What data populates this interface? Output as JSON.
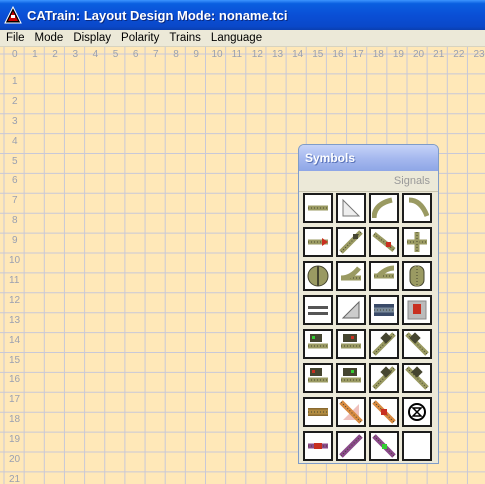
{
  "window": {
    "title": "CATrain: Layout Design Mode: noname.tci"
  },
  "menu": {
    "items": [
      "File",
      "Mode",
      "Display",
      "Polarity",
      "Trains",
      "Language"
    ]
  },
  "grid": {
    "columns": [
      "0",
      "1",
      "2",
      "3",
      "4",
      "5",
      "6",
      "7",
      "8",
      "9",
      "10",
      "11",
      "12",
      "13",
      "14",
      "15",
      "16",
      "17",
      "18",
      "19",
      "20",
      "21",
      "22",
      "23"
    ],
    "rows": [
      "0",
      "1",
      "2",
      "3",
      "4",
      "5",
      "6",
      "7",
      "8",
      "9",
      "10",
      "11",
      "12",
      "13",
      "14",
      "15",
      "16",
      "17",
      "18",
      "19",
      "20",
      "21"
    ],
    "background_color": "#FFE8B8",
    "line_color": "#c8c8d8"
  },
  "palette": {
    "title": "Symbols",
    "tab_label": "Signals",
    "symbols": [
      "straight-track-icon",
      "corner-track-icon",
      "curve-track-left-icon",
      "curve-track-right-icon",
      "straight-block-arrow-icon",
      "turnout-diagonal-icon",
      "turnout-left-icon",
      "crossing-icon",
      "turntable-icon",
      "turnout-block-icon",
      "turnout-block-right-icon",
      "curved-crossing-icon",
      "double-track-icon",
      "diagonal-wedge-icon",
      "double-crossing-icon",
      "track-sign-icon",
      "block-signal-left-icon",
      "block-signal-right-icon",
      "signal-diagonal-left-icon",
      "signal-diagonal-right-icon",
      "block-signal-left-alt-icon",
      "block-signal-right-alt-icon",
      "signal-diagonal-alt-icon",
      "signal-diagonal-alt-right-icon",
      "brown-straight-icon",
      "diagonal-red-icon",
      "diagonal-orange-icon",
      "hourglass-icon",
      "purple-straight-icon",
      "purple-diagonal-icon",
      "purple-turnout-icon",
      "empty-slot-icon"
    ]
  }
}
